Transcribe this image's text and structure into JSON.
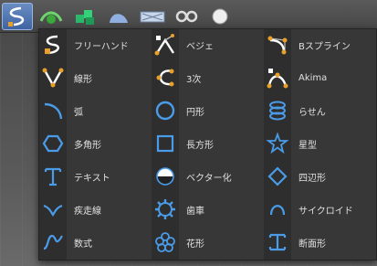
{
  "menu": {
    "items": [
      [
        "フリーハンド",
        "ベジェ",
        "Bスプライン"
      ],
      [
        "線形",
        "3次",
        "Akima"
      ],
      [
        "弧",
        "円形",
        "らせん"
      ],
      [
        "多角形",
        "長方形",
        "星型"
      ],
      [
        "テキスト",
        "ベクター化",
        "四辺形"
      ],
      [
        "疾走線",
        "歯車",
        "サイクロイド"
      ],
      [
        "数式",
        "花形",
        "断面形"
      ]
    ]
  },
  "colors": {
    "icon_blue": "#4a9be8",
    "curve_orange": "#e8a02a",
    "menu_bg": "#373737"
  }
}
